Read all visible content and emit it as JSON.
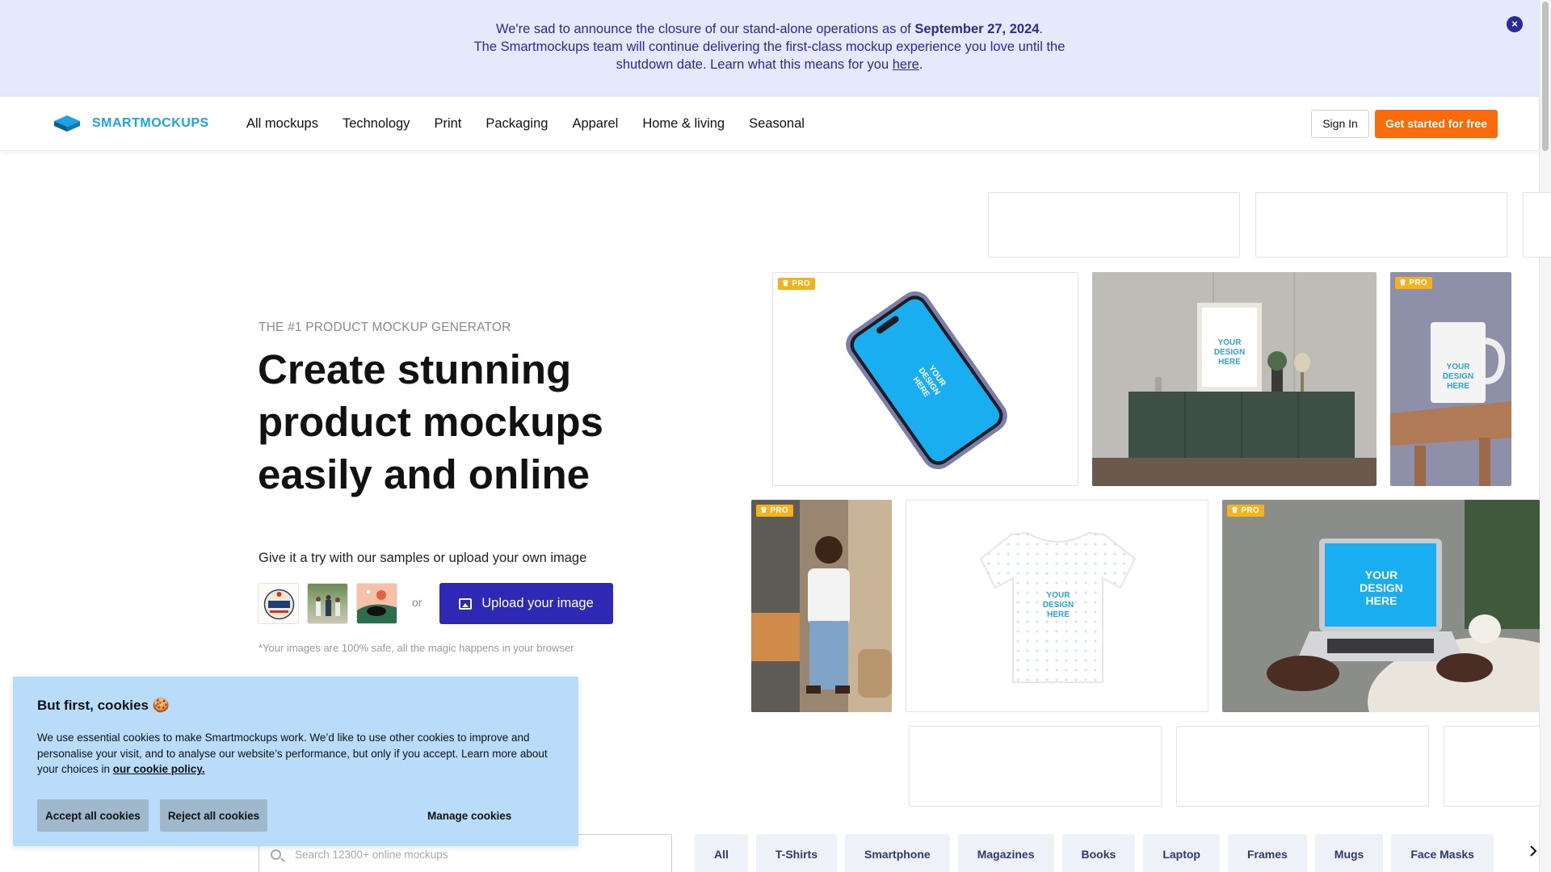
{
  "banner": {
    "line1_prefix": "We're sad to announce the closure of our stand-alone operations as of ",
    "line1_date": "September 27, 2024",
    "line1_suffix": ".",
    "line2": "The Smartmockups team will continue delivering the first-class mockup experience you love until the",
    "line3_prefix": "shutdown date. Learn what this means for you ",
    "line3_link": "here",
    "line3_suffix": ".",
    "close_icon": "×"
  },
  "nav": {
    "logo_text": "SMARTMOCKUPS",
    "links": [
      "All mockups",
      "Technology",
      "Print",
      "Packaging",
      "Apparel",
      "Home & living",
      "Seasonal"
    ],
    "signin_label": "Sign In",
    "start_label": "Get started for free"
  },
  "hero": {
    "eyebrow": "THE #1 PRODUCT MOCKUP GENERATOR",
    "headline": "Create stunning product mockups easily and online",
    "try_label": "Give it a try with our samples or upload your own image",
    "sample1_text": "Road RUNNER Co.",
    "or_text": "or",
    "upload_label": "Upload your image",
    "safe_note": "*Your images are 100% safe, all the magic happens in your browser"
  },
  "mockups": {
    "pro_label": "PRO",
    "placeholder_text": "YOUR DESIGN HERE"
  },
  "cookie": {
    "title": "But first, cookies 🍪",
    "text": "We use essential cookies to make Smartmockups work. We’d like to use other cookies to improve and personalise your visit, and to analyse our website’s performance, but only if you accept. Learn more about your choices in ",
    "link": "our cookie policy.",
    "accept_label": "Accept all cookies",
    "reject_label": "Reject all cookies",
    "manage_label": "Manage cookies"
  },
  "search": {
    "placeholder": "Search 12300+ online mockups"
  },
  "filters": [
    "All",
    "T-Shirts",
    "Smartphone",
    "Magazines",
    "Books",
    "Laptop",
    "Frames",
    "Mugs",
    "Face Masks"
  ],
  "colors": {
    "banner_bg": "#e6e8fb",
    "banner_text": "#2d2a96",
    "brand_blue": "#1aa3e4",
    "cta_orange": "#fa6b0c",
    "upload_indigo": "#2e28b5",
    "pro_badge": "#f6b21a",
    "cookie_bg": "#b8dcfa"
  },
  "icons": {
    "close": "close-icon",
    "logo": "smartmockups-logo-icon",
    "upload": "image-upload-icon",
    "search": "search-icon",
    "pro": "crown-icon",
    "next": "chevron-right-icon"
  }
}
